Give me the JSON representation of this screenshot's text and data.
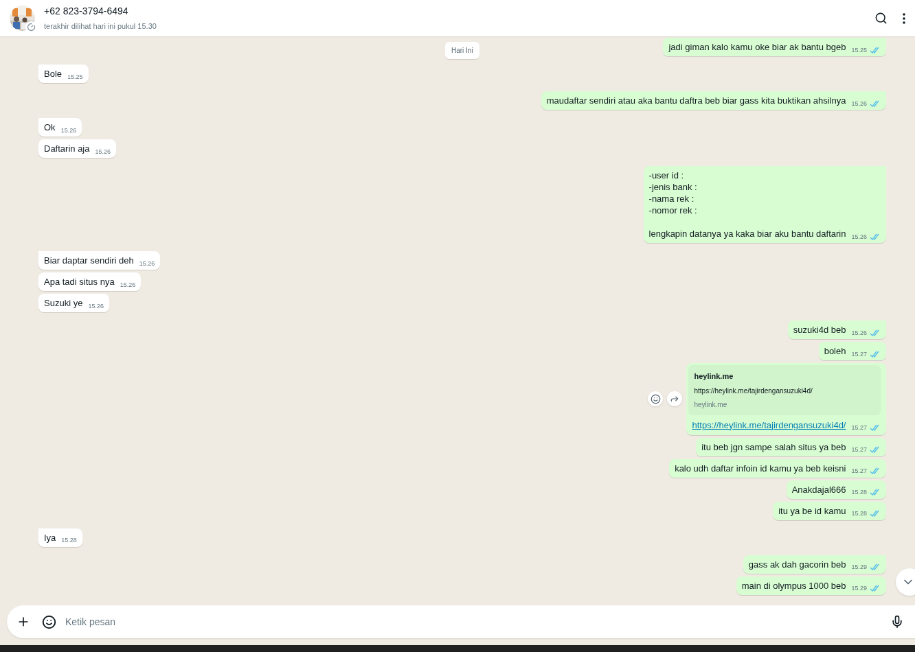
{
  "header": {
    "name": "+62 823-3794-6494",
    "status": "terakhir dilihat hari ini pukul 15.30"
  },
  "date_chip": "Hari Ini",
  "messages": [
    {
      "kind": "text",
      "outgoing": true,
      "tail": true,
      "text": "jadi giman kalo kamu oke biar ak bantu bgeb",
      "time": "15.25",
      "read": true
    },
    {
      "kind": "text",
      "outgoing": false,
      "tail": true,
      "text": "Bole",
      "time": "15.25"
    },
    {
      "kind": "text",
      "outgoing": true,
      "tail": true,
      "text": "maudaftar sendiri atau aka bantu daftra beb biar gass kita buktikan ahsilnya",
      "time": "15.26",
      "read": true
    },
    {
      "kind": "text",
      "outgoing": false,
      "tail": true,
      "text": "Ok",
      "time": "15.26"
    },
    {
      "kind": "text",
      "outgoing": false,
      "tail": false,
      "text": "Daftarin aja",
      "time": "15.26"
    },
    {
      "kind": "text",
      "outgoing": true,
      "tail": true,
      "text": "-user id :\n-jenis bank :\n-nama rek :\n-nomor rek :\n\nlengkapin datanya ya kaka biar aku bantu daftarin",
      "time": "15.26",
      "read": true
    },
    {
      "kind": "text",
      "outgoing": false,
      "tail": true,
      "text": "Biar daptar sendiri deh",
      "time": "15.26"
    },
    {
      "kind": "text",
      "outgoing": false,
      "tail": false,
      "text": "Apa tadi situs nya",
      "time": "15.26"
    },
    {
      "kind": "text",
      "outgoing": false,
      "tail": false,
      "text": "Suzuki ye",
      "time": "15.26"
    },
    {
      "kind": "text",
      "outgoing": true,
      "tail": true,
      "text": "suzuki4d beb",
      "time": "15.26",
      "read": true
    },
    {
      "kind": "text",
      "outgoing": true,
      "tail": false,
      "text": "boleh",
      "time": "15.27",
      "read": true
    },
    {
      "kind": "link",
      "outgoing": true,
      "tail": false,
      "preview": {
        "title": "heylink.me",
        "url": "https://heylink.me/tajirdengansuzuki4d/",
        "domain": "heylink.me"
      },
      "text": "https://heylink.me/tajirdengansuzuki4d/",
      "time": "15.27",
      "read": true
    },
    {
      "kind": "text",
      "outgoing": true,
      "tail": false,
      "text": "itu beb jgn sampe salah situs ya beb",
      "time": "15.27",
      "read": true
    },
    {
      "kind": "text",
      "outgoing": true,
      "tail": false,
      "text": "kalo udh daftar infoin id kamu ya beb keisni",
      "time": "15.27",
      "read": true
    },
    {
      "kind": "text",
      "outgoing": true,
      "tail": false,
      "text": "Anakdajal666",
      "time": "15.28",
      "read": true
    },
    {
      "kind": "text",
      "outgoing": true,
      "tail": false,
      "text": "itu ya be id kamu",
      "time": "15.28",
      "read": true
    },
    {
      "kind": "text",
      "outgoing": false,
      "tail": true,
      "text": "Iya",
      "time": "15.28"
    },
    {
      "kind": "text",
      "outgoing": true,
      "tail": true,
      "text": "gass ak dah gacorin beb",
      "time": "15.29",
      "read": true
    },
    {
      "kind": "text",
      "outgoing": true,
      "tail": false,
      "text": "main di olympus 1000 beb",
      "time": "15.29",
      "read": true
    }
  ],
  "composer": {
    "placeholder": "Ketik pesan"
  }
}
